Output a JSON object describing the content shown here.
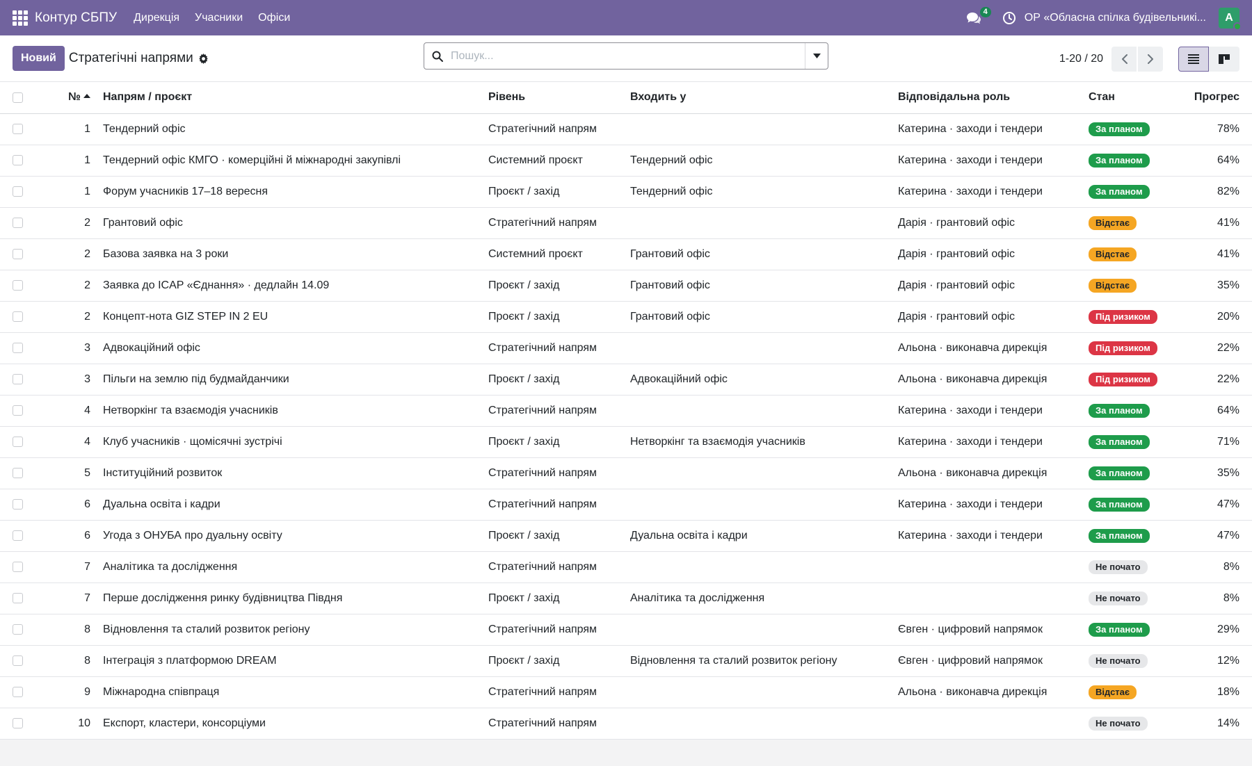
{
  "navbar": {
    "brand": "Контур СБПУ",
    "menu": [
      "Дирекція",
      "Учасники",
      "Офіси"
    ],
    "chat_count": "4",
    "company": "ОР «Обласна спілка будівельникі...",
    "avatar_initial": "A",
    "accent": "#71639e"
  },
  "control": {
    "new_label": "Новий",
    "title": "Стратегічні напрями",
    "search_placeholder": "Пошук...",
    "pager": "1-20 / 20"
  },
  "table": {
    "columns": {
      "num": "№",
      "name": "Напрям / проєкт",
      "level": "Рівень",
      "parent": "Входить у",
      "role": "Відповідальна роль",
      "state": "Стан",
      "progress": "Прогрес"
    },
    "rows": [
      {
        "num": "1",
        "name": "Тендерний офіс",
        "level": "Стратегічний напрям",
        "parent": "",
        "role": "Катерина · заходи і тендери",
        "state": "За планом",
        "state_color": "green",
        "progress": "78%"
      },
      {
        "num": "1",
        "name": "Тендерний офіс КМГО · комерційні й міжнародні закупівлі",
        "level": "Системний проєкт",
        "parent": "Тендерний офіс",
        "role": "Катерина · заходи і тендери",
        "state": "За планом",
        "state_color": "green",
        "progress": "64%"
      },
      {
        "num": "1",
        "name": "Форум учасників 17–18 вересня",
        "level": "Проєкт / захід",
        "parent": "Тендерний офіс",
        "role": "Катерина · заходи і тендери",
        "state": "За планом",
        "state_color": "green",
        "progress": "82%"
      },
      {
        "num": "2",
        "name": "Грантовий офіс",
        "level": "Стратегічний напрям",
        "parent": "",
        "role": "Дарія · грантовий офіс",
        "state": "Відстає",
        "state_color": "orange",
        "progress": "41%"
      },
      {
        "num": "2",
        "name": "Базова заявка на 3 роки",
        "level": "Системний проєкт",
        "parent": "Грантовий офіс",
        "role": "Дарія · грантовий офіс",
        "state": "Відстає",
        "state_color": "orange",
        "progress": "41%"
      },
      {
        "num": "2",
        "name": "Заявка до ICAP «Єднання» · дедлайн 14.09",
        "level": "Проєкт / захід",
        "parent": "Грантовий офіс",
        "role": "Дарія · грантовий офіс",
        "state": "Відстає",
        "state_color": "orange",
        "progress": "35%"
      },
      {
        "num": "2",
        "name": "Концепт-нота GIZ STEP IN 2 EU",
        "level": "Проєкт / захід",
        "parent": "Грантовий офіс",
        "role": "Дарія · грантовий офіс",
        "state": "Під ризиком",
        "state_color": "red",
        "progress": "20%"
      },
      {
        "num": "3",
        "name": "Адвокаційний офіс",
        "level": "Стратегічний напрям",
        "parent": "",
        "role": "Альона · виконавча дирекція",
        "state": "Під ризиком",
        "state_color": "red",
        "progress": "22%"
      },
      {
        "num": "3",
        "name": "Пільги на землю під будмайданчики",
        "level": "Проєкт / захід",
        "parent": "Адвокаційний офіс",
        "role": "Альона · виконавча дирекція",
        "state": "Під ризиком",
        "state_color": "red",
        "progress": "22%"
      },
      {
        "num": "4",
        "name": "Нетворкінг та взаємодія учасників",
        "level": "Стратегічний напрям",
        "parent": "",
        "role": "Катерина · заходи і тендери",
        "state": "За планом",
        "state_color": "green",
        "progress": "64%"
      },
      {
        "num": "4",
        "name": "Клуб учасників · щомісячні зустрічі",
        "level": "Проєкт / захід",
        "parent": "Нетворкінг та взаємодія учасників",
        "role": "Катерина · заходи і тендери",
        "state": "За планом",
        "state_color": "green",
        "progress": "71%"
      },
      {
        "num": "5",
        "name": "Інституційний розвиток",
        "level": "Стратегічний напрям",
        "parent": "",
        "role": "Альона · виконавча дирекція",
        "state": "За планом",
        "state_color": "green",
        "progress": "35%"
      },
      {
        "num": "6",
        "name": "Дуальна освіта і кадри",
        "level": "Стратегічний напрям",
        "parent": "",
        "role": "Катерина · заходи і тендери",
        "state": "За планом",
        "state_color": "green",
        "progress": "47%"
      },
      {
        "num": "6",
        "name": "Угода з ОНУБА про дуальну освіту",
        "level": "Проєкт / захід",
        "parent": "Дуальна освіта і кадри",
        "role": "Катерина · заходи і тендери",
        "state": "За планом",
        "state_color": "green",
        "progress": "47%"
      },
      {
        "num": "7",
        "name": "Аналітика та дослідження",
        "level": "Стратегічний напрям",
        "parent": "",
        "role": "",
        "state": "Не почато",
        "state_color": "grey",
        "progress": "8%"
      },
      {
        "num": "7",
        "name": "Перше дослідження ринку будівництва Півдня",
        "level": "Проєкт / захід",
        "parent": "Аналітика та дослідження",
        "role": "",
        "state": "Не почато",
        "state_color": "grey",
        "progress": "8%"
      },
      {
        "num": "8",
        "name": "Відновлення та сталий розвиток регіону",
        "level": "Стратегічний напрям",
        "parent": "",
        "role": "Євген · цифровий напрямок",
        "state": "За планом",
        "state_color": "green",
        "progress": "29%"
      },
      {
        "num": "8",
        "name": "Інтеграція з платформою DREAM",
        "level": "Проєкт / захід",
        "parent": "Відновлення та сталий розвиток регіону",
        "role": "Євген · цифровий напрямок",
        "state": "Не почато",
        "state_color": "grey",
        "progress": "12%"
      },
      {
        "num": "9",
        "name": "Міжнародна співпраця",
        "level": "Стратегічний напрям",
        "parent": "",
        "role": "Альона · виконавча дирекція",
        "state": "Відстає",
        "state_color": "orange",
        "progress": "18%"
      },
      {
        "num": "10",
        "name": "Експорт, кластери, консорціуми",
        "level": "Стратегічний напрям",
        "parent": "",
        "role": "",
        "state": "Не почато",
        "state_color": "grey",
        "progress": "14%"
      }
    ]
  }
}
